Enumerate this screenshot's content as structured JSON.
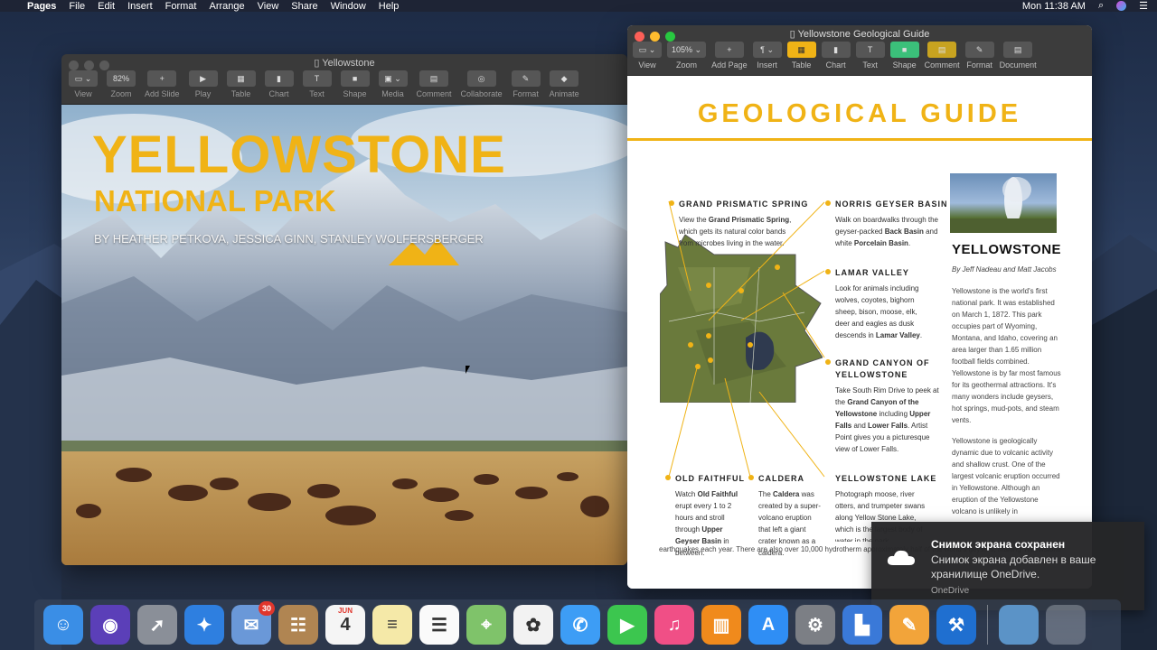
{
  "menubar": {
    "app_name": "Pages",
    "items": [
      "File",
      "Edit",
      "Insert",
      "Format",
      "Arrange",
      "View",
      "Share",
      "Window",
      "Help"
    ],
    "clock": "Mon 11:38 AM"
  },
  "keynote": {
    "title": "Yellowstone",
    "zoom": "82%",
    "toolbar": [
      {
        "label": "View",
        "btn": "▭ ⌄"
      },
      {
        "label": "Zoom",
        "btn": "82%"
      },
      {
        "label": "Add Slide",
        "btn": "+"
      },
      {
        "label": "Play",
        "btn": "▶"
      },
      {
        "label": "Table",
        "btn": "▦"
      },
      {
        "label": "Chart",
        "btn": "▮"
      },
      {
        "label": "Text",
        "btn": "T"
      },
      {
        "label": "Shape",
        "btn": "■"
      },
      {
        "label": "Media",
        "btn": "▣ ⌄"
      },
      {
        "label": "Comment",
        "btn": "▤"
      },
      {
        "label": "Collaborate",
        "btn": "◎"
      },
      {
        "label": "Format",
        "btn": "✎"
      },
      {
        "label": "Animate",
        "btn": "◆"
      }
    ],
    "slide": {
      "title": "YELLOWSTONE",
      "subtitle": "NATIONAL PARK",
      "authors": "BY HEATHER PETKOVA, JESSICA GINN, STANLEY WOLFERSBERGER"
    }
  },
  "pages": {
    "title": "Yellowstone Geological Guide",
    "toolbar": [
      {
        "label": "View",
        "btn": "▭ ⌄"
      },
      {
        "label": "Zoom",
        "btn": "105% ⌄"
      },
      {
        "label": "Add Page",
        "btn": "+"
      },
      {
        "label": "Insert",
        "btn": "¶ ⌄"
      },
      {
        "label": "Table",
        "btn": "▦"
      },
      {
        "label": "Chart",
        "btn": "▮"
      },
      {
        "label": "Text",
        "btn": "T"
      },
      {
        "label": "Shape",
        "btn": "■"
      },
      {
        "label": "Comment",
        "btn": "▤"
      },
      {
        "label": "Format",
        "btn": "✎"
      },
      {
        "label": "Document",
        "btn": "▤"
      }
    ],
    "doc": {
      "heading": "GEOLOGICAL GUIDE",
      "features": {
        "grand_prismatic": {
          "h": "GRAND PRISMATIC SPRING",
          "pre": "View the ",
          "b": "Grand Prismatic Spring",
          "post": ", which gets its natural color bands from microbes living in the water."
        },
        "norris": {
          "h": "NORRIS GEYSER BASIN",
          "pre": "Walk on boardwalks through the geyser-packed ",
          "b": "Back Basin",
          "mid": " and white ",
          "b2": "Porcelain Basin",
          "post": "."
        },
        "lamar": {
          "h": "LAMAR VALLEY",
          "pre": "Look for animals including wolves, coyotes, bighorn sheep, bison, moose, elk, deer and eagles as dusk descends in ",
          "b": "Lamar Valley",
          "post": "."
        },
        "canyon": {
          "h1": "GRAND CANYON OF",
          "h2": "YELLOWSTONE",
          "pre": "Take South Rim Drive to peek at the ",
          "b": "Grand Canyon of the Yellowstone",
          "mid": " including ",
          "b2": "Upper Falls",
          "mid2": " and ",
          "b3": "Lower Falls",
          "post": ". Artist Point gives you a picturesque view of Lower Falls."
        },
        "old_faithful": {
          "h": "OLD FAITHFUL",
          "pre": "Watch ",
          "b": "Old Faithful",
          "mid": " erupt every 1 to 2 hours and stroll through ",
          "b2": "Upper Geyser Basin",
          "post": " in between."
        },
        "caldera": {
          "h": "CALDERA",
          "pre": "The ",
          "b": "Caldera",
          "post": " was created by a super-volcano eruption that left a giant crater known as a caldera."
        },
        "lake": {
          "h": "YELLOWSTONE LAKE",
          "body": "Photograph moose, river otters, and trumpeter swans along Yellow Stone Lake, which is the largest body of water in the park."
        }
      },
      "side": {
        "title": "YELLOWSTONE",
        "byline": "By Jeff Nadeau and Matt Jacobs",
        "p1": "Yellowstone is the world's first national park. It was established on March 1, 1872. This park occupies part of Wyoming, Montana, and Idaho, covering an area larger than 1.65 million football fields combined. Yellowstone is by far most famous for its geothermal attractions. It's many wonders include geysers, hot springs, mud-pots, and steam vents.",
        "p2": "Yellowstone is geologically dynamic due to volcanic activity and shallow crust. One of the largest volcanic eruption occurred in Yellowstone. Although an eruption of the Yellowstone volcano is unlikely in"
      },
      "bottom": "earthquakes each year. There are also over 10,000 hydrotherm approximately half of the world's geysers, making Yellowstone"
    }
  },
  "notification": {
    "title": "Снимок экрана сохранен",
    "body": "Снимок экрана добавлен в ваше хранилище OneDrive.",
    "app": "OneDrive"
  },
  "dock": {
    "apps": [
      {
        "name": "finder",
        "color": "#3a8ee6",
        "glyph": "☺"
      },
      {
        "name": "siri",
        "color": "#5b3fb8",
        "glyph": "◉"
      },
      {
        "name": "launchpad",
        "color": "#8a8f98",
        "glyph": "➚"
      },
      {
        "name": "safari",
        "color": "#2e7fe0",
        "glyph": "✦"
      },
      {
        "name": "mail",
        "color": "#6a98d8",
        "glyph": "✉",
        "badge": "30"
      },
      {
        "name": "contacts",
        "color": "#b08552",
        "glyph": "☷"
      },
      {
        "name": "calendar",
        "color": "#f5f5f5",
        "glyph": "4"
      },
      {
        "name": "notes",
        "color": "#f5e9a8",
        "glyph": "≡"
      },
      {
        "name": "reminders",
        "color": "#fafafa",
        "glyph": "☰"
      },
      {
        "name": "maps",
        "color": "#7fc36a",
        "glyph": "⌖"
      },
      {
        "name": "photos",
        "color": "#f2f2f2",
        "glyph": "✿"
      },
      {
        "name": "messages",
        "color": "#3d9df5",
        "glyph": "✆"
      },
      {
        "name": "facetime",
        "color": "#3cc64f",
        "glyph": "▶"
      },
      {
        "name": "itunes",
        "color": "#f04f86",
        "glyph": "♫"
      },
      {
        "name": "books",
        "color": "#f08a1c",
        "glyph": "▥"
      },
      {
        "name": "app-store",
        "color": "#2f8ef5",
        "glyph": "A"
      },
      {
        "name": "system-preferences",
        "color": "#7c7f85",
        "glyph": "⚙"
      },
      {
        "name": "keynote",
        "color": "#3a79d8",
        "glyph": "▙"
      },
      {
        "name": "pages",
        "color": "#f2a43a",
        "glyph": "✎"
      },
      {
        "name": "xcode",
        "color": "#1f6fd0",
        "glyph": "⚒"
      }
    ],
    "calendar_month": "JUN",
    "calendar_day": "4"
  }
}
